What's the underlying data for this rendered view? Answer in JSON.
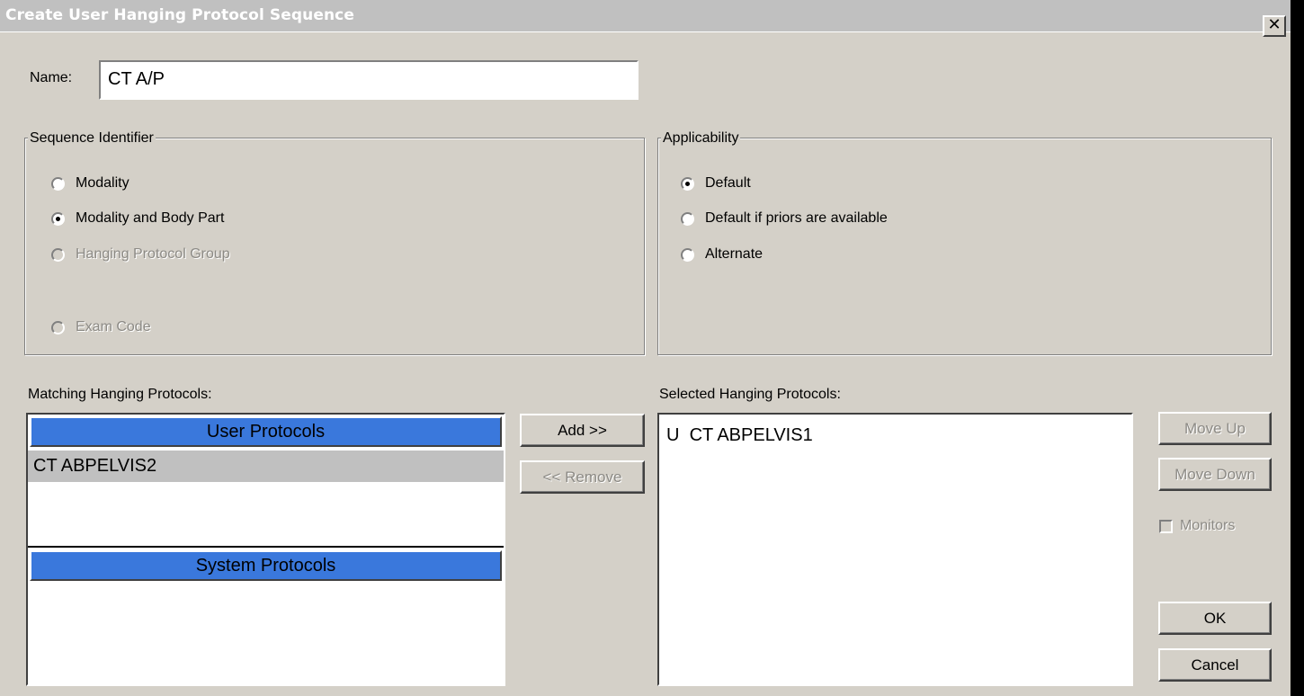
{
  "window": {
    "title": "Create User Hanging Protocol Sequence",
    "close_glyph": "✕"
  },
  "name": {
    "label": "Name:",
    "value": "CT A/P"
  },
  "sequence_identifier": {
    "legend": "Sequence Identifier",
    "options": [
      "Modality",
      "Modality and Body Part",
      "Hanging Protocol Group",
      "Exam Code"
    ],
    "selected": "Modality and Body Part"
  },
  "applicability": {
    "legend": "Applicability",
    "options": [
      "Default",
      "Default if priors are available",
      "Alternate"
    ],
    "selected": "Default"
  },
  "matching": {
    "label": "Matching Hanging Protocols:",
    "user_header": "User Protocols",
    "user_items": [
      "CT ABPELVIS2"
    ],
    "system_header": "System Protocols"
  },
  "buttons": {
    "add": "Add >>",
    "remove": "<< Remove",
    "move_up": "Move Up",
    "move_down": "Move Down",
    "ok": "OK",
    "cancel": "Cancel"
  },
  "selected": {
    "label": "Selected Hanging Protocols:",
    "items": [
      {
        "type": "U",
        "name": "CT ABPELVIS1"
      }
    ]
  },
  "monitors": {
    "label": "Monitors",
    "checked": false
  }
}
